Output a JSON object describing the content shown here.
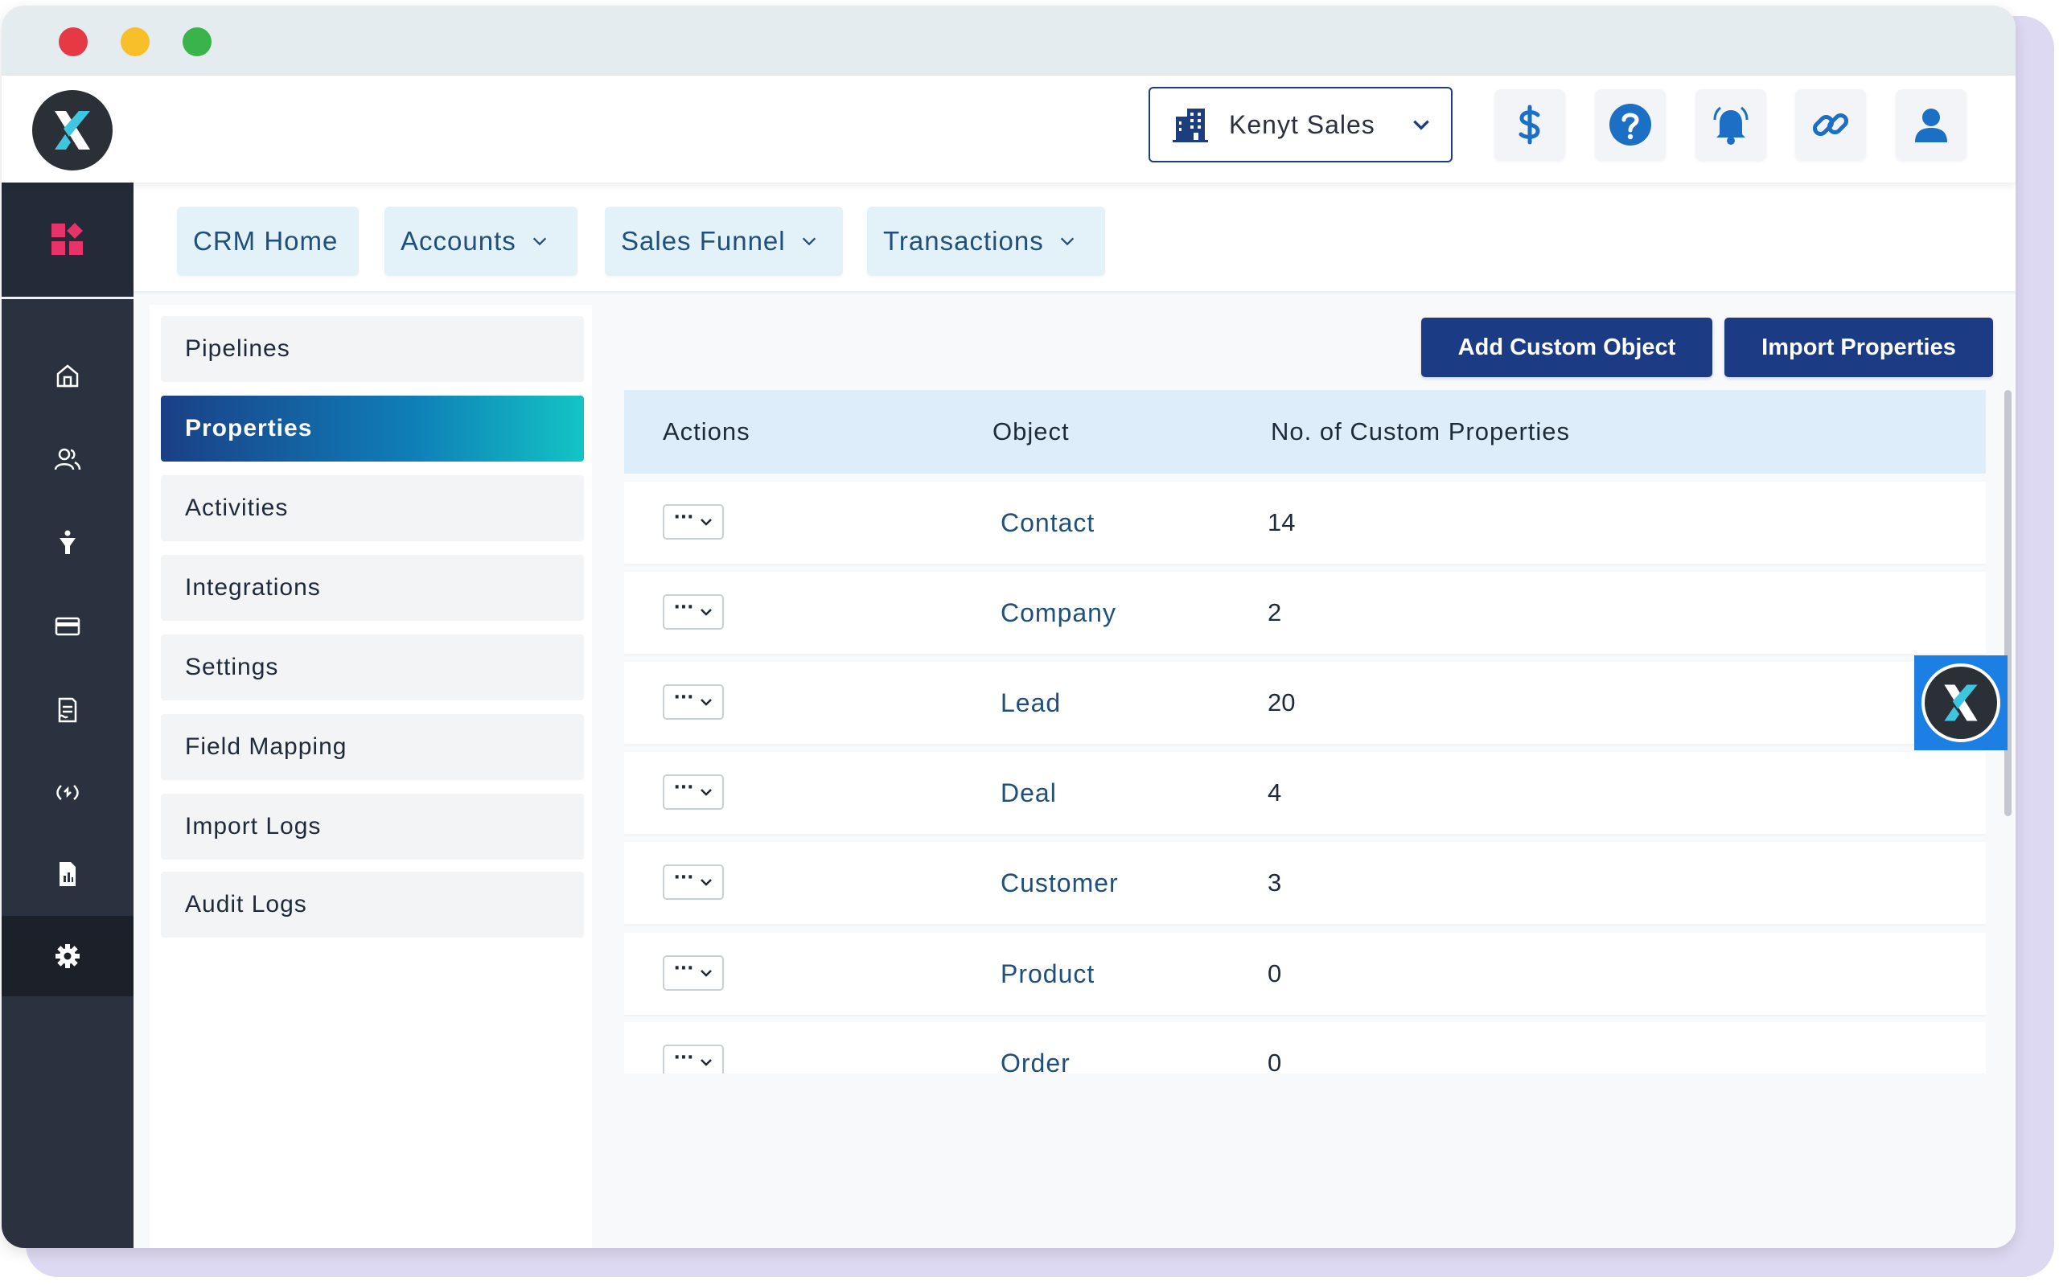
{
  "window": {
    "traffic_lights": [
      "close",
      "minimize",
      "zoom"
    ]
  },
  "header": {
    "account_name": "Kenyt Sales",
    "icons": [
      "dollar-icon",
      "help-icon",
      "bell-icon",
      "link-icon",
      "user-icon"
    ]
  },
  "sidebar": {
    "icons": [
      "apps-icon",
      "home-icon",
      "contacts-icon",
      "funnel-icon",
      "card-icon",
      "document-icon",
      "sync-icon",
      "report-icon",
      "settings-icon"
    ],
    "active": "settings-icon"
  },
  "nav": {
    "tabs": [
      {
        "label": "CRM Home",
        "dropdown": false
      },
      {
        "label": "Accounts",
        "dropdown": true
      },
      {
        "label": "Sales Funnel",
        "dropdown": true
      },
      {
        "label": "Transactions",
        "dropdown": true
      }
    ]
  },
  "menu": {
    "items": [
      {
        "label": "Pipelines"
      },
      {
        "label": "Properties"
      },
      {
        "label": "Activities"
      },
      {
        "label": "Integrations"
      },
      {
        "label": "Settings"
      },
      {
        "label": "Field Mapping"
      },
      {
        "label": "Import Logs"
      },
      {
        "label": "Audit Logs"
      }
    ],
    "active_label": "Properties"
  },
  "toolbar": {
    "add_custom_object": "Add Custom Object",
    "import_properties": "Import Properties"
  },
  "table": {
    "columns": [
      "Actions",
      "Object",
      "No. of Custom Properties"
    ],
    "action_symbol": "···",
    "rows": [
      {
        "object": "Contact",
        "count": "14"
      },
      {
        "object": "Company",
        "count": "2"
      },
      {
        "object": "Lead",
        "count": "20"
      },
      {
        "object": "Deal",
        "count": "4"
      },
      {
        "object": "Customer",
        "count": "3"
      },
      {
        "object": "Product",
        "count": "0"
      },
      {
        "object": "Order",
        "count": "0"
      }
    ]
  },
  "colors": {
    "primary": "#1b3b84",
    "accent_pink": "#e8336a",
    "sidebar_bg": "#2a3240",
    "link_blue": "#1f4f7a",
    "active_gradient_end": "#13c4c4"
  }
}
